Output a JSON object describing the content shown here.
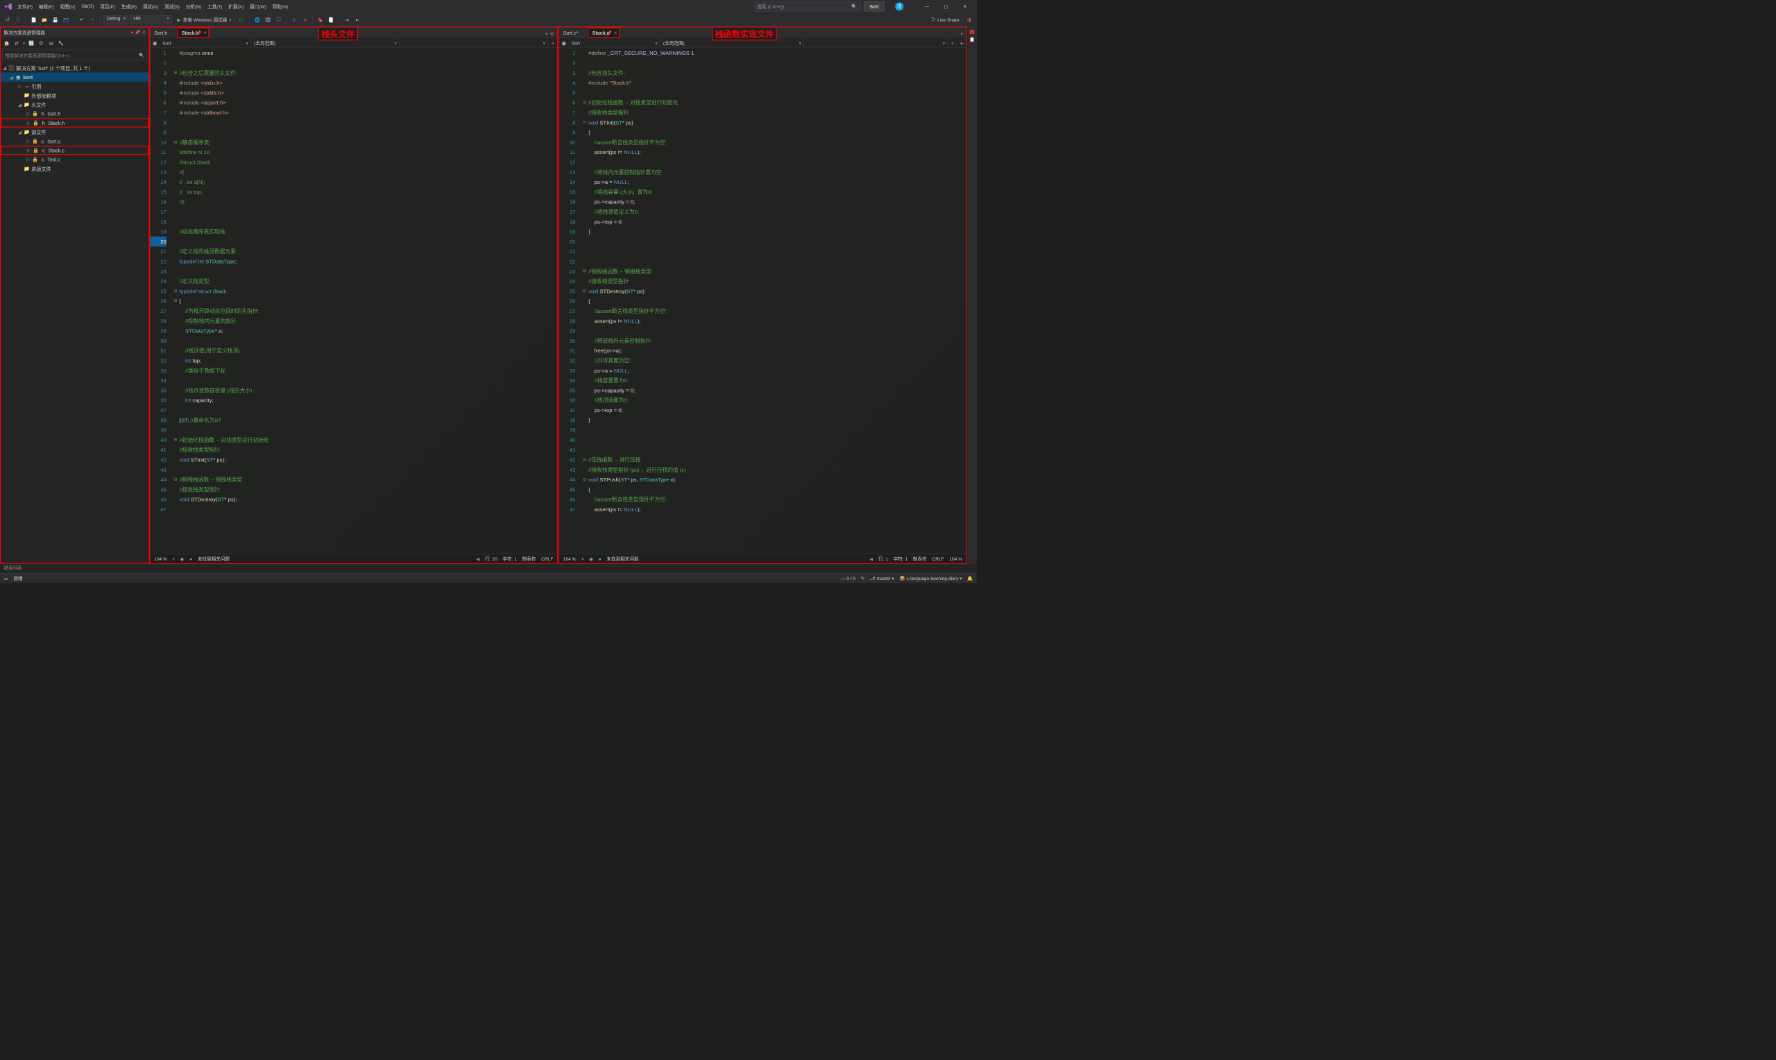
{
  "menubar": {
    "items": [
      "文件(F)",
      "编辑(E)",
      "视图(V)",
      "Git(G)",
      "项目(P)",
      "生成(B)",
      "调试(D)",
      "测试(S)",
      "分析(N)",
      "工具(T)",
      "扩展(X)",
      "窗口(W)",
      "帮助(H)"
    ],
    "search_placeholder": "搜索 (Ctrl+Q)",
    "sort_btn": "Sort",
    "avatar": "培"
  },
  "toolbar": {
    "config": "Debug",
    "platform": "x86",
    "run": "本地 Windows 调试器",
    "liveshare": "Live Share"
  },
  "explorer": {
    "title": "解决方案资源管理器",
    "search": "搜索解决方案资源管理器(Ctrl+;)",
    "solution": "解决方案 'Sort' (1 个项目, 共 1 个)",
    "project": "Sort",
    "refs": "引用",
    "external": "外部依赖项",
    "headers": "头文件",
    "files_h": [
      "Sort.h",
      "Stack.h"
    ],
    "sources": "源文件",
    "files_c": [
      "Sort.c",
      "Stack.c",
      "Test.c"
    ],
    "resources": "资源文件"
  },
  "editor_left": {
    "tabs": [
      "Sort.h",
      "Stack.h"
    ],
    "nav1": "Sort",
    "nav2": "(全局范围)",
    "annotation": "栈头文件",
    "lines": [
      [
        1,
        "<span class='c-pp'>#pragma</span> <span class='c-id'>once</span>"
      ],
      [
        2,
        ""
      ],
      [
        3,
        "<span class='c-cm'>//包含之后需要的头文件:</span>"
      ],
      [
        4,
        "<span class='c-pp'>#include</span> <span class='c-str'>&lt;stdio.h&gt;</span>"
      ],
      [
        5,
        "<span class='c-pp'>#include</span> <span class='c-str'>&lt;stdlib.h&gt;</span>"
      ],
      [
        6,
        "<span class='c-pp'>#include</span> <span class='c-str'>&lt;assert.h&gt;</span>"
      ],
      [
        7,
        "<span class='c-pp'>#include</span> <span class='c-str'>&lt;stdbool.h&gt;</span>"
      ],
      [
        8,
        ""
      ],
      [
        9,
        ""
      ],
      [
        10,
        "<span class='c-cm'>//静态顺序表:</span>"
      ],
      [
        11,
        "<span class='c-cm'>//define N 10</span>"
      ],
      [
        12,
        "<span class='c-cm'>//struct Stack</span>"
      ],
      [
        13,
        "<span class='c-cm'>//{</span>"
      ],
      [
        14,
        "<span class='c-cm'>//   int a[N];</span>"
      ],
      [
        15,
        "<span class='c-cm'>//   int top;</span>"
      ],
      [
        16,
        "<span class='c-cm'>//};</span>"
      ],
      [
        17,
        ""
      ],
      [
        18,
        ""
      ],
      [
        19,
        "<span class='c-cm'>//动态顺序表实现栈:</span>"
      ],
      [
        20,
        ""
      ],
      [
        21,
        "<span class='c-cm'>//定义栈的栈顶数据元素:</span>"
      ],
      [
        22,
        "<span class='c-kw'>typedef</span> <span class='c-kw'>int</span> <span class='c-ty'>STDataType</span>;"
      ],
      [
        23,
        ""
      ],
      [
        24,
        "<span class='c-cm'>//定义栈类型:</span>"
      ],
      [
        25,
        "<span class='c-kw'>typedef</span> <span class='c-kw'>struct</span> <span class='c-ty'>Stack</span>"
      ],
      [
        26,
        "{"
      ],
      [
        27,
        "    <span class='c-cm'>//为栈开辟动态空间时的头指针:</span>"
      ],
      [
        28,
        "    <span class='c-cm'>//控制栈内元素的指针</span>"
      ],
      [
        29,
        "    <span class='c-ty'>STDataType</span>* a;"
      ],
      [
        30,
        ""
      ],
      [
        31,
        "    <span class='c-cm'>//栈顶值(用于定义栈顶):</span>"
      ],
      [
        32,
        "    <span class='c-kw'>int</span> top;"
      ],
      [
        33,
        "    <span class='c-cm'>//类似于数组下标</span>"
      ],
      [
        34,
        ""
      ],
      [
        35,
        "    <span class='c-cm'>//栈存放数据容量 (栈的大小) :</span>"
      ],
      [
        36,
        "    <span class='c-kw'>int</span> capacity;"
      ],
      [
        37,
        ""
      ],
      [
        38,
        "}<span class='c-ty'>ST</span>; <span class='c-cm'>//重命名为ST</span>"
      ],
      [
        39,
        ""
      ],
      [
        40,
        "<span class='c-cm'>//初始化栈函数 -- 对栈类型进行初始化</span>"
      ],
      [
        41,
        "<span class='c-cm'>//接收栈类型指针</span>"
      ],
      [
        42,
        "<span class='c-kw'>void</span> <span class='c-fn'>STInit</span>(<span class='c-ty'>ST</span>* ps);"
      ],
      [
        43,
        ""
      ],
      [
        44,
        "<span class='c-cm'>//销毁栈函数 -- 销毁栈类型</span>"
      ],
      [
        45,
        "<span class='c-cm'>//接收栈类型指针</span>"
      ],
      [
        46,
        "<span class='c-kw'>void</span> <span class='c-fn'>STDestroy</span>(<span class='c-ty'>ST</span>* ps);"
      ],
      [
        47,
        ""
      ]
    ],
    "status": {
      "zoom": "104 %",
      "issue": "未找到相关问题",
      "line": "行: 20",
      "col": "字符: 1",
      "tabs": "制表符",
      "eol": "CRLF"
    }
  },
  "editor_right": {
    "tabs": [
      "Sort.c*",
      "Stack.c"
    ],
    "nav1": "Sort",
    "nav2": "(全局范围)",
    "annotation": "栈函数实现文件",
    "lines": [
      [
        1,
        "<span class='c-pp'>#define</span> <span class='c-mac'>_CRT_SECURE_NO_WARNINGS</span> 1"
      ],
      [
        2,
        ""
      ],
      [
        3,
        "<span class='c-cm'>//包含栈头文件:</span>"
      ],
      [
        4,
        "<span class='c-pp'>#include</span> <span class='c-str'>\"Stack.h\"</span>"
      ],
      [
        5,
        ""
      ],
      [
        6,
        "<span class='c-cm'>//初始化栈函数 -- 对栈类型进行初始化</span>"
      ],
      [
        7,
        "<span class='c-cm'>//接收栈类型指针</span>"
      ],
      [
        8,
        "<span class='c-kw'>void</span> <span class='c-fn'>STInit</span>(<span class='c-ty'>ST</span>* ps)"
      ],
      [
        9,
        "{"
      ],
      [
        10,
        "    <span class='c-cm'>//assert断言栈类型指针不为空:</span>"
      ],
      [
        11,
        "    <span class='c-fn'>assert</span>(ps != <span class='c-kw'>NULL</span>);"
      ],
      [
        12,
        ""
      ],
      [
        13,
        "    <span class='c-cm'>//将栈内元素控制指针置为空:</span>"
      ],
      [
        14,
        "    ps-&gt;a = <span class='c-kw'>NULL</span>;"
      ],
      [
        15,
        "    <span class='c-cm'>//将栈容量 (大小)  置为0:</span>"
      ],
      [
        16,
        "    ps-&gt;capacity = 0;"
      ],
      [
        17,
        "    <span class='c-cm'>//将栈顶值定义为0:</span>"
      ],
      [
        18,
        "    ps-&gt;top = 0;"
      ],
      [
        19,
        "}"
      ],
      [
        20,
        ""
      ],
      [
        21,
        ""
      ],
      [
        22,
        ""
      ],
      [
        23,
        "<span class='c-cm'>//销毁栈函数 -- 销毁栈类型</span>"
      ],
      [
        24,
        "<span class='c-cm'>//接收栈类型指针</span>"
      ],
      [
        25,
        "<span class='c-kw'>void</span> <span class='c-fn'>STDestroy</span>(<span class='c-ty'>ST</span>* ps)"
      ],
      [
        26,
        "{"
      ],
      [
        27,
        "    <span class='c-cm'>//assert断言栈类型指针不为空:</span>"
      ],
      [
        28,
        "    <span class='c-fn'>assert</span>(ps != <span class='c-kw'>NULL</span>);"
      ],
      [
        29,
        ""
      ],
      [
        30,
        "    <span class='c-cm'>//释放栈内元素控制指针:</span>"
      ],
      [
        31,
        "    <span class='c-fn'>free</span>(ps-&gt;a);"
      ],
      [
        32,
        "    <span class='c-cm'>//并将其置为空:</span>"
      ],
      [
        33,
        "    ps-&gt;a = <span class='c-kw'>NULL</span>;"
      ],
      [
        34,
        "    <span class='c-cm'>//栈容量置为0:</span>"
      ],
      [
        35,
        "    ps-&gt;capacity = 0;"
      ],
      [
        36,
        "    <span class='c-cm'>//栈顶值置为0:</span>"
      ],
      [
        37,
        "    ps-&gt;top = 0;"
      ],
      [
        38,
        "}"
      ],
      [
        39,
        ""
      ],
      [
        40,
        ""
      ],
      [
        41,
        ""
      ],
      [
        42,
        "<span class='c-cm'>//压栈函数 -- 进行压栈</span>"
      ],
      [
        43,
        "<span class='c-cm'>//接收栈类型指针 (ps) 、进行压栈的值 (x)</span>"
      ],
      [
        44,
        "<span class='c-kw'>void</span> <span class='c-fn'>STPush</span>(<span class='c-ty'>ST</span>* ps, <span class='c-ty'>STDataType</span> x)"
      ],
      [
        45,
        "{"
      ],
      [
        46,
        "    <span class='c-cm'>//assert断言栈类型指针不为空:</span>"
      ],
      [
        47,
        "    <span class='c-fn'>assert</span>(ps != <span class='c-kw'>NULL</span>);"
      ]
    ],
    "status": {
      "zoom": "104 %",
      "issue": "未找到相关问题",
      "line": "行: 1",
      "col": "字符: 1",
      "tabs": "制表符",
      "eol": "CRLF",
      "extra": "104 %"
    }
  },
  "bottom": {
    "errlist": "错误列表",
    "ready": "就绪",
    "counts": "0 / 0",
    "branch": "master",
    "repo": "c-language-learning-diary"
  }
}
